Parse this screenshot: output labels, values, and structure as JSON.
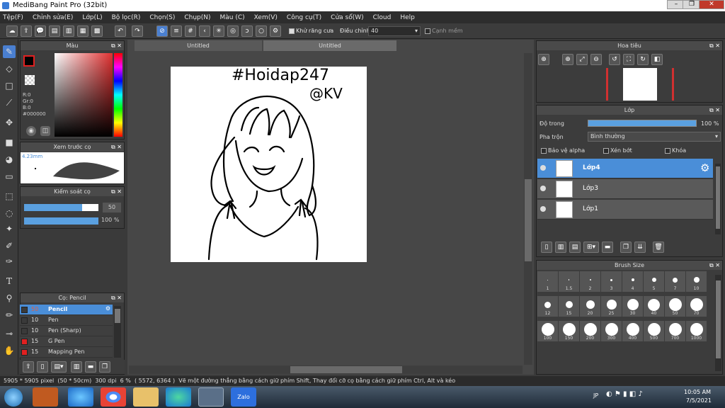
{
  "window": {
    "title": "MediBang Paint Pro (32bit)"
  },
  "menu": [
    "Tệp(F)",
    "Chỉnh sửa(E)",
    "Lớp(L)",
    "Bộ lọc(R)",
    "Chọn(S)",
    "Chụp(N)",
    "Màu (C)",
    "Xem(V)",
    "Công cụ(T)",
    "Cửa sổ(W)",
    "Cloud",
    "Help"
  ],
  "toolbar": {
    "antialias_label": "Khử răng cưa",
    "correction_label": "Điều chỉnh",
    "correction_value": "40",
    "snap_label": "Cạnh mềm"
  },
  "color_panel": {
    "title": "Màu",
    "r": "R:0",
    "g": "Gr:0",
    "b": "B:0",
    "hex": "#000000",
    "fg": "#000000",
    "bg": "#ffffff"
  },
  "preview_panel": {
    "title": "Xem trước cọ",
    "size": "4.23mm"
  },
  "brush_control": {
    "title": "Kiểm soát cọ",
    "size": "50",
    "opacity": "100 %",
    "size_fraction": 0.78,
    "opacity_fraction": 1.0
  },
  "brush_panel": {
    "title": "Cọ: Pencil",
    "items": [
      {
        "size": "50",
        "name": "Pencil",
        "color": "#3a3a3a",
        "selected": true
      },
      {
        "size": "10",
        "name": "Pen",
        "color": "#3a3a3a"
      },
      {
        "size": "10",
        "name": "Pen (Sharp)",
        "color": "#3a3a3a"
      },
      {
        "size": "15",
        "name": "G Pen",
        "color": "#e02020"
      },
      {
        "size": "15",
        "name": "Mapping Pen",
        "color": "#e02020"
      }
    ]
  },
  "tabs": [
    "Untitled",
    "Untitled"
  ],
  "canvas": {
    "text1": "#Hoidap247",
    "text2": "@KV"
  },
  "navigator": {
    "title": "Hoa tiêu"
  },
  "layer_panel": {
    "title": "Lớp",
    "opacity_label": "Độ trong",
    "opacity_value": "100 %",
    "blend_label": "Pha trộn",
    "blend_value": "Bình thường",
    "protect_alpha": "Bảo vệ alpha",
    "clipping": "Xén bớt",
    "lock": "Khóa",
    "layers": [
      {
        "name": "Lớp4",
        "selected": true
      },
      {
        "name": "Lớp3"
      },
      {
        "name": "Lớp1"
      }
    ]
  },
  "brush_size_panel": {
    "title": "Brush Size",
    "sizes": [
      "1",
      "1.5",
      "2",
      "3",
      "4",
      "5",
      "7",
      "10",
      "12",
      "15",
      "20",
      "25",
      "30",
      "40",
      "50",
      "70",
      "100",
      "150",
      "200",
      "300",
      "400",
      "500",
      "700",
      "1000"
    ]
  },
  "status": {
    "dims": "5905 * 5905 pixel",
    "cm": "(50 * 50cm)",
    "dpi": "300 dpi",
    "zoom": "6 %",
    "coords": "( 5572, 6364 )",
    "hint": "Vẽ một đường thẳng bằng cách giữ phím Shift, Thay đổi cỡ cọ bằng cách giữ phím Ctrl, Alt và kéo"
  },
  "taskbar": {
    "lang": "JP",
    "time": "10:05 AM",
    "date": "7/5/2021",
    "zalo": "Zalo"
  }
}
